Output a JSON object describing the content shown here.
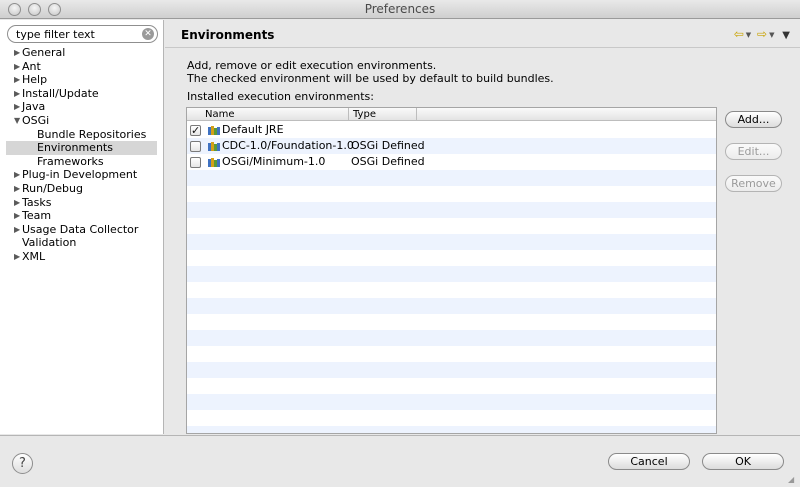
{
  "window": {
    "title": "Preferences"
  },
  "filter": {
    "value": "type filter text"
  },
  "tree": [
    {
      "label": "General",
      "arrow": "▶",
      "child": false,
      "selected": false
    },
    {
      "label": "Ant",
      "arrow": "▶",
      "child": false,
      "selected": false
    },
    {
      "label": "Help",
      "arrow": "▶",
      "child": false,
      "selected": false
    },
    {
      "label": "Install/Update",
      "arrow": "▶",
      "child": false,
      "selected": false
    },
    {
      "label": "Java",
      "arrow": "▶",
      "child": false,
      "selected": false
    },
    {
      "label": "OSGi",
      "arrow": "▼",
      "child": false,
      "selected": false
    },
    {
      "label": "Bundle Repositories",
      "arrow": "",
      "child": true,
      "selected": false
    },
    {
      "label": "Environments",
      "arrow": "",
      "child": true,
      "selected": true
    },
    {
      "label": "Frameworks",
      "arrow": "",
      "child": true,
      "selected": false
    },
    {
      "label": "Plug-in Development",
      "arrow": "▶",
      "child": false,
      "selected": false
    },
    {
      "label": "Run/Debug",
      "arrow": "▶",
      "child": false,
      "selected": false
    },
    {
      "label": "Tasks",
      "arrow": "▶",
      "child": false,
      "selected": false
    },
    {
      "label": "Team",
      "arrow": "▶",
      "child": false,
      "selected": false
    },
    {
      "label": "Usage Data Collector",
      "arrow": "▶",
      "child": false,
      "selected": false
    },
    {
      "label": "Validation",
      "arrow": "",
      "child": false,
      "selected": false
    },
    {
      "label": "XML",
      "arrow": "▶",
      "child": false,
      "selected": false
    }
  ],
  "page": {
    "title": "Environments",
    "desc_line1": "Add, remove or edit execution environments.",
    "desc_line2": "The checked environment will be used by default to build bundles.",
    "installed_label": "Installed execution environments:"
  },
  "table": {
    "columns": {
      "name": "Name",
      "type": "Type"
    },
    "rows": [
      {
        "name": "Default JRE",
        "type": "",
        "checked": true
      },
      {
        "name": "CDC-1.0/Foundation-1.0",
        "type": "OSGi Defined",
        "checked": false
      },
      {
        "name": "OSGi/Minimum-1.0",
        "type": "OSGi Defined",
        "checked": false
      }
    ]
  },
  "buttons": {
    "add": "Add...",
    "edit": "Edit...",
    "remove": "Remove",
    "cancel": "Cancel",
    "ok": "OK",
    "help": "?"
  },
  "icons": {
    "back": "⇦",
    "forward": "⇨",
    "menu": "▼",
    "dropdown": "▼",
    "clear": "✕",
    "check": "✓"
  },
  "colors": {
    "selection": "#d6d6d6",
    "stripe": "#edf3fe",
    "nav_arrow": "#c9a200"
  }
}
